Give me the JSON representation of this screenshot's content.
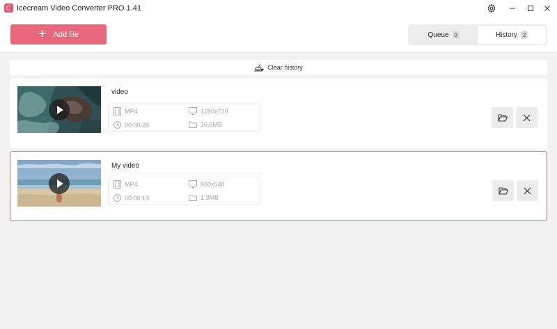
{
  "window": {
    "title": "Icecream Video Converter PRO 1.41"
  },
  "toolbar": {
    "add_label": "Add file"
  },
  "tabs": [
    {
      "label": "Queue",
      "count": "0"
    },
    {
      "label": "History",
      "count": "2"
    }
  ],
  "clear_history": {
    "label": "Clear history"
  },
  "videos": [
    {
      "title": "video",
      "format": "MP4",
      "resolution": "1280x720",
      "duration": "00:00:28",
      "size": "16.6MB"
    },
    {
      "title": "My video",
      "format": "MP4",
      "resolution": "960x540",
      "duration": "00:00:13",
      "size": "1.3MB"
    }
  ],
  "icons": {
    "app": "icecream-logo-icon",
    "settings": "gear-icon",
    "minimize": "minimize-icon",
    "maximize": "maximize-icon",
    "close": "close-icon",
    "add": "plus-icon",
    "clear": "broom-icon",
    "play": "play-icon",
    "format": "film-icon",
    "resolution": "monitor-icon",
    "duration": "clock-icon",
    "size": "folder-icon",
    "open_folder": "open-folder-icon",
    "remove": "close-icon"
  },
  "colors": {
    "accent": "#e8677c",
    "selected_border": "#e4647d",
    "background": "#f2f2f2"
  }
}
